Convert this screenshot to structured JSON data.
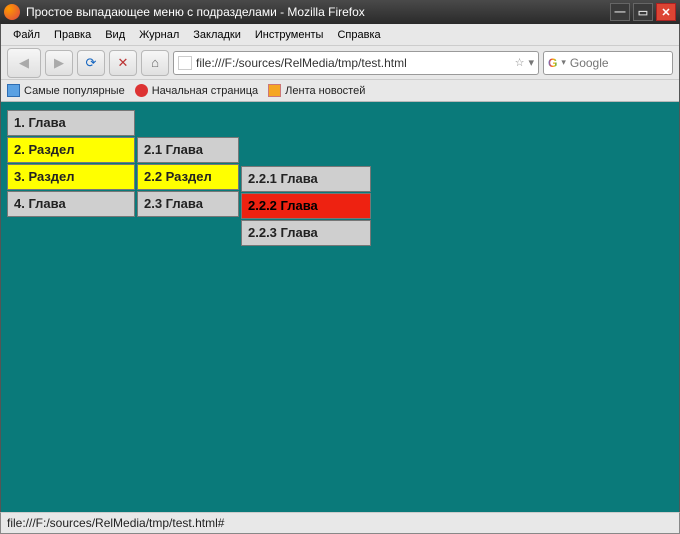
{
  "window": {
    "title": "Простое выпадающее меню с подразделами - Mozilla Firefox"
  },
  "menubar": {
    "file": "Файл",
    "edit": "Правка",
    "view": "Вид",
    "history": "Журнал",
    "bookmarks": "Закладки",
    "tools": "Инструменты",
    "help": "Справка"
  },
  "url": "file:///F:/sources/RelMedia/tmp/test.html",
  "search_placeholder": "Google",
  "bookmarks": {
    "popular": "Самые популярные",
    "start": "Начальная страница",
    "feed": "Лента новостей"
  },
  "menu": {
    "level0": [
      {
        "label": "1. Глава",
        "state": "normal"
      },
      {
        "label": "2. Раздел",
        "state": "yellow"
      },
      {
        "label": "3. Раздел",
        "state": "yellow"
      },
      {
        "label": "4. Глава",
        "state": "normal"
      }
    ],
    "level1": [
      {
        "label": "2.1 Глава",
        "state": "normal"
      },
      {
        "label": "2.2 Раздел",
        "state": "yellow"
      },
      {
        "label": "2.3 Глава",
        "state": "normal"
      }
    ],
    "level2": [
      {
        "label": "2.2.1 Глава",
        "state": "normal"
      },
      {
        "label": "2.2.2 Глава",
        "state": "red"
      },
      {
        "label": "2.2.3 Глава",
        "state": "normal"
      }
    ]
  },
  "status": "file:///F:/sources/RelMedia/tmp/test.html#"
}
